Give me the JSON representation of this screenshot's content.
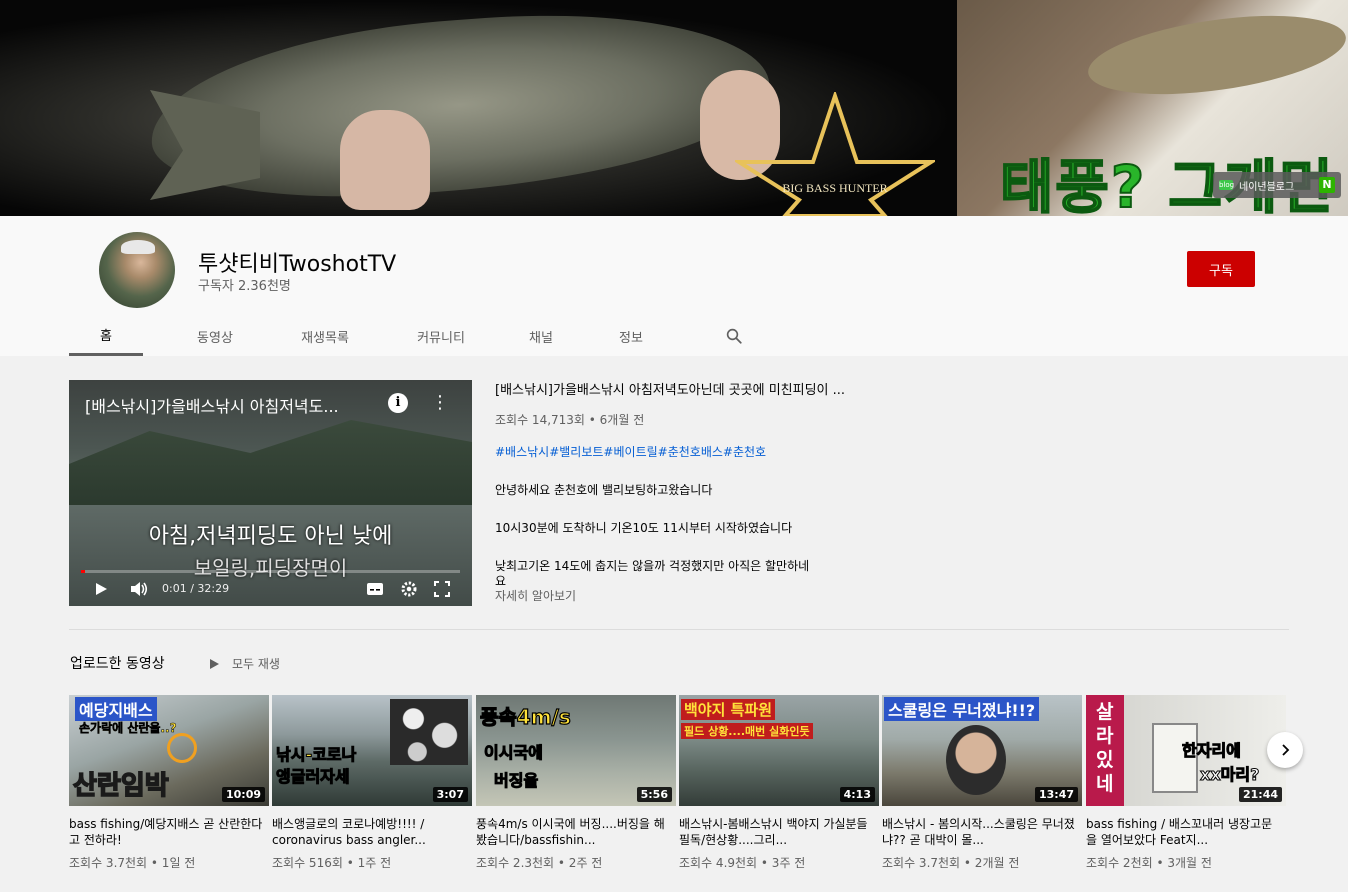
{
  "banner": {
    "logo_text": "BIG BASS HUNTER",
    "overlay_text": "태풍? 그게먼",
    "blog_chip_label": "네이년블로그",
    "blog_chip_badge": "N"
  },
  "channel": {
    "name": "투샷티비TwoshotTV",
    "subscribers": "구독자 2.36천명",
    "subscribe_label": "구독"
  },
  "tabs": [
    {
      "label": "홈",
      "active": true
    },
    {
      "label": "동영상",
      "active": false
    },
    {
      "label": "재생목록",
      "active": false
    },
    {
      "label": "커뮤니티",
      "active": false
    },
    {
      "label": "채널",
      "active": false
    },
    {
      "label": "정보",
      "active": false
    }
  ],
  "featured": {
    "player_title": "[배스낚시]가을배스낚시 아침저녁도...",
    "subtitle_line1": "아침,저녁피딩도 아닌 낮에",
    "subtitle_line2": "보일링,피딩장면이",
    "time": "0:01 / 32:29",
    "progress_fraction": 0.01,
    "title": "[배스낚시]가을배스낚시 아침저녁도아닌데 곳곳에 미친피딩이 ...",
    "meta": "조회수 14,713회 • 6개월 전",
    "tags": "#배스낚시#밸리보트#베이트릴#춘천호배스#춘천호",
    "desc_lines": [
      "안녕하세요 춘천호에 밸리보팅하고왔습니다",
      "10시30분에 도착하니 기온10도 11시부터 시작하였습니다",
      "낮최고기온 14도에 춥지는 않을까 걱정했지만 아직은 할만하네",
      "요"
    ],
    "more_label": "자세히 알아보기"
  },
  "uploads": {
    "section_title": "업로드한 동영상",
    "play_all_label": "모두 재생",
    "videos": [
      {
        "title": "bass fishing/예당지배스 곧 산란한다고 전하라!",
        "meta": "조회수 3.7천회 • 1일 전",
        "duration": "10:09",
        "overlay": [
          "예당지배스",
          "손가락에 산란을..?",
          "산란임박"
        ]
      },
      {
        "title": "배스앵글로의 코로나예방!!!! / coronavirus bass angler...",
        "meta": "조회수 516회 • 1주 전",
        "duration": "3:07",
        "overlay": [
          "낚시-코로나",
          "앵글러자세"
        ]
      },
      {
        "title": "풍속4m/s 이시국에 버징....버징을 해봤습니다/bassfishin...",
        "meta": "조회수 2.3천회 • 2주 전",
        "duration": "5:56",
        "overlay": [
          "풍속4m/s",
          "이시국에",
          "버징을"
        ]
      },
      {
        "title": "배스낚시-봄배스낚시 백야지 가실분들 필독/현상황....그리...",
        "meta": "조회수 4.9천회 • 3주 전",
        "duration": "4:13",
        "overlay": [
          "백야지 특파원",
          "필드 상황....매번 실화인듯"
        ]
      },
      {
        "title": "배스낚시 - 봄의시작...스쿨링은 무너졌냐?? 곧 대박이 몰...",
        "meta": "조회수 3.7천회 • 2개월 전",
        "duration": "13:47",
        "overlay": [
          "스쿨링은 무너졌냐!!?"
        ]
      },
      {
        "title": "bass fishing / 배스꼬내러 냉장고문을 열어보았다 Feat지...",
        "meta": "조회수 2천회 • 3개월 전",
        "duration": "21:44",
        "overlay": [
          "살",
          "라",
          "있",
          "네",
          "한자리에",
          "xx마리?"
        ]
      }
    ]
  },
  "colors": {
    "subscribe_red": "#cc0000",
    "link_blue": "#065fd4",
    "meta_gray": "#606060",
    "banner_green": "#29b52a"
  },
  "icons": {
    "search": "search-icon",
    "play": "play-icon",
    "volume": "volume-icon",
    "captions": "captions-icon",
    "settings": "gear-icon",
    "fullscreen": "fullscreen-icon",
    "info": "info-icon",
    "more": "more-vert-icon",
    "next": "chevron-right-icon"
  }
}
